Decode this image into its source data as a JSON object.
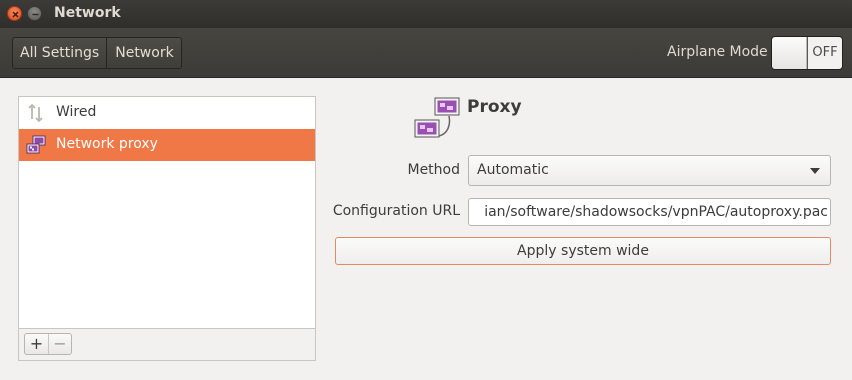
{
  "window": {
    "title": "Network"
  },
  "header": {
    "breadcrumbs": [
      "All Settings",
      "Network"
    ],
    "airplane_label": "Airplane Mode",
    "airplane_state": "OFF"
  },
  "sidebar": {
    "items": [
      {
        "label": "Wired",
        "icon": "wired-arrows-icon",
        "selected": false
      },
      {
        "label": "Network proxy",
        "icon": "network-proxy-icon",
        "selected": true
      }
    ],
    "add_label": "+",
    "remove_label": "−"
  },
  "proxy": {
    "title": "Proxy",
    "method_label": "Method",
    "method_value": "Automatic",
    "config_url_label": "Configuration URL",
    "config_url_value": "ian/software/shadowsocks/vpnPAC/autoproxy.pac",
    "apply_label": "Apply system wide"
  },
  "colors": {
    "accent": "#f07746",
    "titlebar": "#3c3b37",
    "close_button": "#df4a16"
  }
}
